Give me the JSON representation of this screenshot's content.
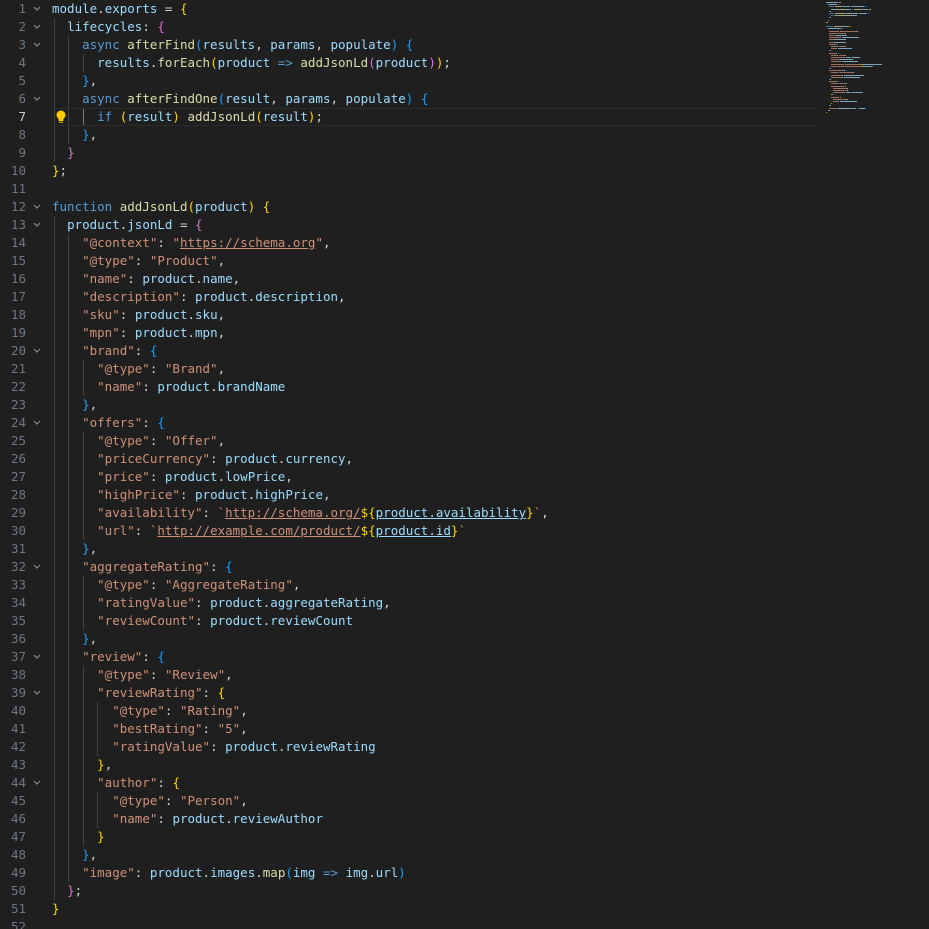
{
  "editor": {
    "active_line": 7,
    "line_numbers": [
      1,
      2,
      3,
      4,
      5,
      6,
      7,
      8,
      9,
      10,
      11,
      12,
      13,
      14,
      15,
      16,
      17,
      18,
      19,
      20,
      21,
      22,
      23,
      24,
      25,
      26,
      27,
      28,
      29,
      30,
      31,
      32,
      33,
      34,
      35,
      36,
      37,
      38,
      39,
      40,
      41,
      42,
      43,
      44,
      45,
      46,
      47,
      48,
      49,
      50,
      51,
      52
    ],
    "fold_lines": [
      1,
      2,
      3,
      6,
      12,
      13,
      20,
      24,
      32,
      37,
      39,
      44
    ],
    "lines": [
      [
        [
          "module",
          "var"
        ],
        [
          ".",
          "p"
        ],
        [
          "exports",
          "var"
        ],
        [
          " = ",
          "p"
        ],
        [
          "{",
          "b1"
        ]
      ],
      [
        [
          "  ",
          "p"
        ],
        [
          "lifecycles",
          "var"
        ],
        [
          ": ",
          "p"
        ],
        [
          "{",
          "b2"
        ]
      ],
      [
        [
          "    ",
          "p"
        ],
        [
          "async ",
          "kw"
        ],
        [
          "afterFind",
          "fn"
        ],
        [
          "(",
          "b3"
        ],
        [
          "results",
          "var"
        ],
        [
          ", ",
          "p"
        ],
        [
          "params",
          "var"
        ],
        [
          ", ",
          "p"
        ],
        [
          "populate",
          "var"
        ],
        [
          ") ",
          "b3"
        ],
        [
          "{",
          "b3"
        ]
      ],
      [
        [
          "      ",
          "p"
        ],
        [
          "results",
          "var"
        ],
        [
          ".",
          "p"
        ],
        [
          "forEach",
          "fn"
        ],
        [
          "(",
          "b1"
        ],
        [
          "product",
          "var"
        ],
        [
          " => ",
          "kw"
        ],
        [
          "addJsonLd",
          "fn"
        ],
        [
          "(",
          "b2"
        ],
        [
          "product",
          "var"
        ],
        [
          ")",
          "b2"
        ],
        [
          ")",
          "b1"
        ],
        [
          ";",
          "p"
        ]
      ],
      [
        [
          "    ",
          "p"
        ],
        [
          "}",
          "b3"
        ],
        [
          ",",
          "p"
        ]
      ],
      [
        [
          "    ",
          "p"
        ],
        [
          "async ",
          "kw"
        ],
        [
          "afterFindOne",
          "fn"
        ],
        [
          "(",
          "b3"
        ],
        [
          "result",
          "var"
        ],
        [
          ", ",
          "p"
        ],
        [
          "params",
          "var"
        ],
        [
          ", ",
          "p"
        ],
        [
          "populate",
          "var"
        ],
        [
          ") ",
          "b3"
        ],
        [
          "{",
          "b3"
        ]
      ],
      [
        [
          "      ",
          "p"
        ],
        [
          "if ",
          "kw"
        ],
        [
          "(",
          "b1"
        ],
        [
          "result",
          "var"
        ],
        [
          ") ",
          "b1"
        ],
        [
          "addJsonLd",
          "fn"
        ],
        [
          "(",
          "b1"
        ],
        [
          "result",
          "var"
        ],
        [
          ")",
          "b1"
        ],
        [
          ";",
          "p"
        ]
      ],
      [
        [
          "    ",
          "p"
        ],
        [
          "}",
          "b3"
        ],
        [
          ",",
          "p"
        ]
      ],
      [
        [
          "  ",
          "p"
        ],
        [
          "}",
          "b2"
        ]
      ],
      [
        [
          "}",
          "b1"
        ],
        [
          ";",
          "p"
        ]
      ],
      [],
      [
        [
          "function ",
          "kw"
        ],
        [
          "addJsonLd",
          "fn"
        ],
        [
          "(",
          "b1"
        ],
        [
          "product",
          "var"
        ],
        [
          ") ",
          "b1"
        ],
        [
          "{",
          "b1"
        ]
      ],
      [
        [
          "  ",
          "p"
        ],
        [
          "product",
          "var"
        ],
        [
          ".",
          "p"
        ],
        [
          "jsonLd",
          "var"
        ],
        [
          " = ",
          "p"
        ],
        [
          "{",
          "b2"
        ]
      ],
      [
        [
          "    ",
          "p"
        ],
        [
          "\"@context\"",
          "key"
        ],
        [
          ": ",
          "p"
        ],
        [
          "\"",
          "str"
        ],
        [
          "https://schema.org",
          "url"
        ],
        [
          "\"",
          "str"
        ],
        [
          ",",
          "p"
        ]
      ],
      [
        [
          "    ",
          "p"
        ],
        [
          "\"@type\"",
          "key"
        ],
        [
          ": ",
          "p"
        ],
        [
          "\"Product\"",
          "str"
        ],
        [
          ",",
          "p"
        ]
      ],
      [
        [
          "    ",
          "p"
        ],
        [
          "\"name\"",
          "key"
        ],
        [
          ": ",
          "p"
        ],
        [
          "product",
          "var"
        ],
        [
          ".",
          "p"
        ],
        [
          "name",
          "var"
        ],
        [
          ",",
          "p"
        ]
      ],
      [
        [
          "    ",
          "p"
        ],
        [
          "\"description\"",
          "key"
        ],
        [
          ": ",
          "p"
        ],
        [
          "product",
          "var"
        ],
        [
          ".",
          "p"
        ],
        [
          "description",
          "var"
        ],
        [
          ",",
          "p"
        ]
      ],
      [
        [
          "    ",
          "p"
        ],
        [
          "\"sku\"",
          "key"
        ],
        [
          ": ",
          "p"
        ],
        [
          "product",
          "var"
        ],
        [
          ".",
          "p"
        ],
        [
          "sku",
          "var"
        ],
        [
          ",",
          "p"
        ]
      ],
      [
        [
          "    ",
          "p"
        ],
        [
          "\"mpn\"",
          "key"
        ],
        [
          ": ",
          "p"
        ],
        [
          "product",
          "var"
        ],
        [
          ".",
          "p"
        ],
        [
          "mpn",
          "var"
        ],
        [
          ",",
          "p"
        ]
      ],
      [
        [
          "    ",
          "p"
        ],
        [
          "\"brand\"",
          "key"
        ],
        [
          ": ",
          "p"
        ],
        [
          "{",
          "b3"
        ]
      ],
      [
        [
          "      ",
          "p"
        ],
        [
          "\"@type\"",
          "key"
        ],
        [
          ": ",
          "p"
        ],
        [
          "\"Brand\"",
          "str"
        ],
        [
          ",",
          "p"
        ]
      ],
      [
        [
          "      ",
          "p"
        ],
        [
          "\"name\"",
          "key"
        ],
        [
          ": ",
          "p"
        ],
        [
          "product",
          "var"
        ],
        [
          ".",
          "p"
        ],
        [
          "brandName",
          "var"
        ]
      ],
      [
        [
          "    ",
          "p"
        ],
        [
          "}",
          "b3"
        ],
        [
          ",",
          "p"
        ]
      ],
      [
        [
          "    ",
          "p"
        ],
        [
          "\"offers\"",
          "key"
        ],
        [
          ": ",
          "p"
        ],
        [
          "{",
          "b3"
        ]
      ],
      [
        [
          "      ",
          "p"
        ],
        [
          "\"@type\"",
          "key"
        ],
        [
          ": ",
          "p"
        ],
        [
          "\"Offer\"",
          "str"
        ],
        [
          ",",
          "p"
        ]
      ],
      [
        [
          "      ",
          "p"
        ],
        [
          "\"priceCurrency\"",
          "key"
        ],
        [
          ": ",
          "p"
        ],
        [
          "product",
          "var"
        ],
        [
          ".",
          "p"
        ],
        [
          "currency",
          "var"
        ],
        [
          ",",
          "p"
        ]
      ],
      [
        [
          "      ",
          "p"
        ],
        [
          "\"price\"",
          "key"
        ],
        [
          ": ",
          "p"
        ],
        [
          "product",
          "var"
        ],
        [
          ".",
          "p"
        ],
        [
          "lowPrice",
          "var"
        ],
        [
          ",",
          "p"
        ]
      ],
      [
        [
          "      ",
          "p"
        ],
        [
          "\"highPrice\"",
          "key"
        ],
        [
          ": ",
          "p"
        ],
        [
          "product",
          "var"
        ],
        [
          ".",
          "p"
        ],
        [
          "highPrice",
          "var"
        ],
        [
          ",",
          "p"
        ]
      ],
      [
        [
          "      ",
          "p"
        ],
        [
          "\"availability\"",
          "key"
        ],
        [
          ": ",
          "p"
        ],
        [
          "`",
          "str"
        ],
        [
          "http://schema.org/",
          "url"
        ],
        [
          "${",
          "tpl"
        ],
        [
          "product.availability",
          "ulvar"
        ],
        [
          "}",
          "tpl"
        ],
        [
          "`",
          "str"
        ],
        [
          ",",
          "p"
        ]
      ],
      [
        [
          "      ",
          "p"
        ],
        [
          "\"url\"",
          "key"
        ],
        [
          ": ",
          "p"
        ],
        [
          "`",
          "str"
        ],
        [
          "http://example.com/product/",
          "url"
        ],
        [
          "${",
          "tpl"
        ],
        [
          "product.id",
          "ulvar"
        ],
        [
          "}",
          "tpl"
        ],
        [
          "`",
          "str"
        ]
      ],
      [
        [
          "    ",
          "p"
        ],
        [
          "}",
          "b3"
        ],
        [
          ",",
          "p"
        ]
      ],
      [
        [
          "    ",
          "p"
        ],
        [
          "\"aggregateRating\"",
          "key"
        ],
        [
          ": ",
          "p"
        ],
        [
          "{",
          "b3"
        ]
      ],
      [
        [
          "      ",
          "p"
        ],
        [
          "\"@type\"",
          "key"
        ],
        [
          ": ",
          "p"
        ],
        [
          "\"AggregateRating\"",
          "str"
        ],
        [
          ",",
          "p"
        ]
      ],
      [
        [
          "      ",
          "p"
        ],
        [
          "\"ratingValue\"",
          "key"
        ],
        [
          ": ",
          "p"
        ],
        [
          "product",
          "var"
        ],
        [
          ".",
          "p"
        ],
        [
          "aggregateRating",
          "var"
        ],
        [
          ",",
          "p"
        ]
      ],
      [
        [
          "      ",
          "p"
        ],
        [
          "\"reviewCount\"",
          "key"
        ],
        [
          ": ",
          "p"
        ],
        [
          "product",
          "var"
        ],
        [
          ".",
          "p"
        ],
        [
          "reviewCount",
          "var"
        ]
      ],
      [
        [
          "    ",
          "p"
        ],
        [
          "}",
          "b3"
        ],
        [
          ",",
          "p"
        ]
      ],
      [
        [
          "    ",
          "p"
        ],
        [
          "\"review\"",
          "key"
        ],
        [
          ": ",
          "p"
        ],
        [
          "{",
          "b3"
        ]
      ],
      [
        [
          "      ",
          "p"
        ],
        [
          "\"@type\"",
          "key"
        ],
        [
          ": ",
          "p"
        ],
        [
          "\"Review\"",
          "str"
        ],
        [
          ",",
          "p"
        ]
      ],
      [
        [
          "      ",
          "p"
        ],
        [
          "\"reviewRating\"",
          "key"
        ],
        [
          ": ",
          "p"
        ],
        [
          "{",
          "b1"
        ]
      ],
      [
        [
          "        ",
          "p"
        ],
        [
          "\"@type\"",
          "key"
        ],
        [
          ": ",
          "p"
        ],
        [
          "\"Rating\"",
          "str"
        ],
        [
          ",",
          "p"
        ]
      ],
      [
        [
          "        ",
          "p"
        ],
        [
          "\"bestRating\"",
          "key"
        ],
        [
          ": ",
          "p"
        ],
        [
          "\"5\"",
          "str"
        ],
        [
          ",",
          "p"
        ]
      ],
      [
        [
          "        ",
          "p"
        ],
        [
          "\"ratingValue\"",
          "key"
        ],
        [
          ": ",
          "p"
        ],
        [
          "product",
          "var"
        ],
        [
          ".",
          "p"
        ],
        [
          "reviewRating",
          "var"
        ]
      ],
      [
        [
          "      ",
          "p"
        ],
        [
          "}",
          "b1"
        ],
        [
          ",",
          "p"
        ]
      ],
      [
        [
          "      ",
          "p"
        ],
        [
          "\"author\"",
          "key"
        ],
        [
          ": ",
          "p"
        ],
        [
          "{",
          "b1"
        ]
      ],
      [
        [
          "        ",
          "p"
        ],
        [
          "\"@type\"",
          "key"
        ],
        [
          ": ",
          "p"
        ],
        [
          "\"Person\"",
          "str"
        ],
        [
          ",",
          "p"
        ]
      ],
      [
        [
          "        ",
          "p"
        ],
        [
          "\"name\"",
          "key"
        ],
        [
          ": ",
          "p"
        ],
        [
          "product",
          "var"
        ],
        [
          ".",
          "p"
        ],
        [
          "reviewAuthor",
          "var"
        ]
      ],
      [
        [
          "      ",
          "p"
        ],
        [
          "}",
          "b1"
        ]
      ],
      [
        [
          "    ",
          "p"
        ],
        [
          "}",
          "b3"
        ],
        [
          ",",
          "p"
        ]
      ],
      [
        [
          "    ",
          "p"
        ],
        [
          "\"image\"",
          "key"
        ],
        [
          ": ",
          "p"
        ],
        [
          "product",
          "var"
        ],
        [
          ".",
          "p"
        ],
        [
          "images",
          "var"
        ],
        [
          ".",
          "p"
        ],
        [
          "map",
          "fn"
        ],
        [
          "(",
          "b3"
        ],
        [
          "img",
          "var"
        ],
        [
          " => ",
          "kw"
        ],
        [
          "img",
          "var"
        ],
        [
          ".",
          "p"
        ],
        [
          "url",
          "var"
        ],
        [
          ")",
          "b3"
        ]
      ],
      [
        [
          "  ",
          "p"
        ],
        [
          "}",
          "b2"
        ],
        [
          ";",
          "p"
        ]
      ],
      [
        [
          "}",
          "b1"
        ]
      ],
      []
    ]
  },
  "theme": {
    "background": "#1f1f1f",
    "colors": {
      "kw": "#569cd6",
      "fn": "#dcdcaa",
      "var": "#9cdcfe",
      "str": "#ce9178",
      "key": "#ce9178",
      "url": "#ce9178",
      "ulvar": "#9cdcfe",
      "tpl": "#ffd700",
      "p": "#d4d4d4",
      "b1": "#ffd700",
      "b2": "#da70d6",
      "b3": "#179fff"
    },
    "lightbulb_color": "#ffcc00"
  },
  "icons": {
    "fold": "chevron-down-icon",
    "lightbulb": "lightbulb-icon"
  }
}
